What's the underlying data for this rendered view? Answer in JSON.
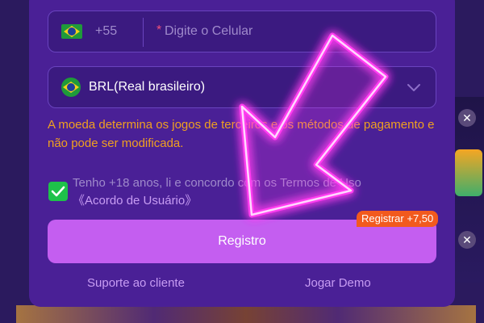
{
  "phone": {
    "country_code": "+55",
    "required_mark": "*",
    "placeholder": "Digite o Celular",
    "flag_icon": "brazil-flag-icon"
  },
  "currency": {
    "selected": "BRL(Real brasileiro)",
    "flag_icon": "brazil-flag-icon"
  },
  "notice": "A moeda determina os jogos de terceiros e os métodos de pagamento e não pode ser modificada.",
  "terms": {
    "checked": true,
    "text": "Tenho +18 anos, li e concordo com os Termos de Uso",
    "link": "《Acordo de Usuário》"
  },
  "register": {
    "button_label": "Registro",
    "bonus_badge": "Registrar +7,50"
  },
  "footer": {
    "support_label": "Suporte ao cliente",
    "demo_label": "Jogar Demo"
  },
  "colors": {
    "modal_bg": "#4a2096",
    "accent_button": "#c45ef0",
    "warning_text": "#f0a020",
    "checkbox": "#1ec24a",
    "arrow_neon": "#ff3cf0"
  }
}
